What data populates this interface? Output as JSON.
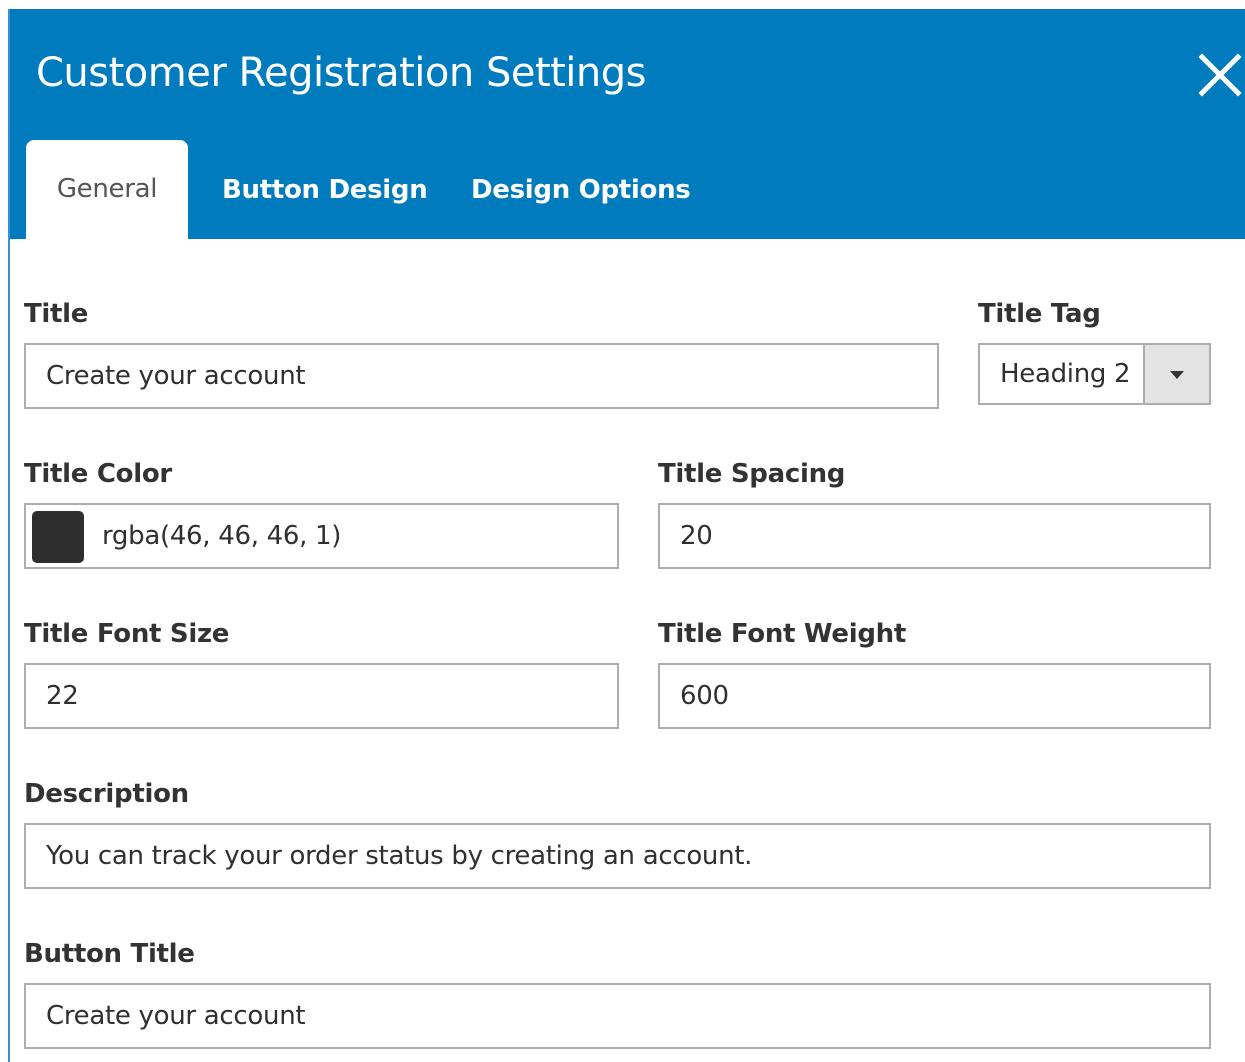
{
  "modal": {
    "title": "Customer Registration Settings",
    "accent_color": "#007bbd"
  },
  "close": {
    "icon": "close-icon"
  },
  "tabs": [
    {
      "label": "General",
      "active": true
    },
    {
      "label": "Button Design",
      "active": false
    },
    {
      "label": "Design Options",
      "active": false
    }
  ],
  "form": {
    "title": {
      "label": "Title",
      "value": "Create your account"
    },
    "title_tag": {
      "label": "Title Tag",
      "value": "Heading 2",
      "icon": "chevron-down-icon"
    },
    "title_color": {
      "label": "Title Color",
      "value": "rgba(46, 46, 46, 1)",
      "swatch_color": "#2e2e2e"
    },
    "title_spacing": {
      "label": "Title Spacing",
      "value": "20"
    },
    "title_font_size": {
      "label": "Title Font Size",
      "value": "22"
    },
    "title_font_weight": {
      "label": "Title Font Weight",
      "value": "600"
    },
    "description": {
      "label": "Description",
      "value": "You can track your order status by creating an account."
    },
    "button_title": {
      "label": "Button Title",
      "value": "Create your account"
    }
  }
}
